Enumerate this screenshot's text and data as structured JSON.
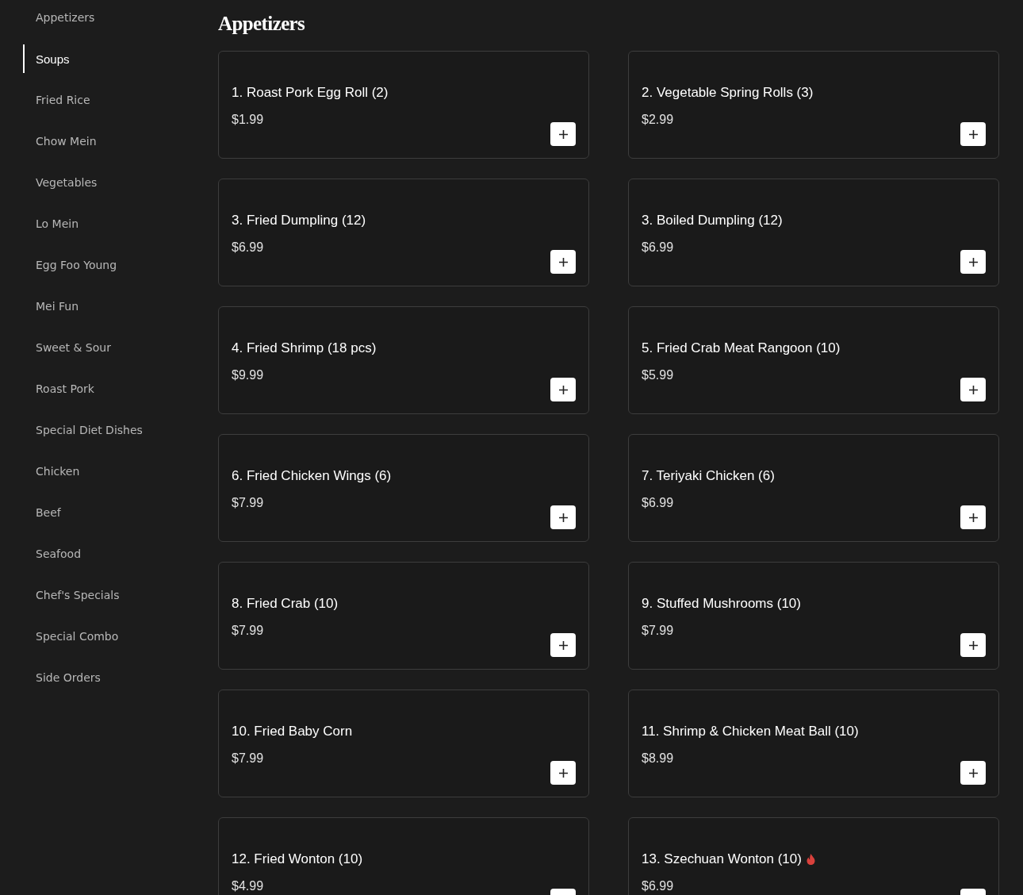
{
  "sidebar": {
    "items": [
      {
        "label": "Appetizers",
        "selected": false
      },
      {
        "label": "Soups",
        "selected": true
      },
      {
        "label": "Fried Rice",
        "selected": false
      },
      {
        "label": "Chow Mein",
        "selected": false
      },
      {
        "label": "Vegetables",
        "selected": false
      },
      {
        "label": "Lo Mein",
        "selected": false
      },
      {
        "label": "Egg Foo Young",
        "selected": false
      },
      {
        "label": "Mei Fun",
        "selected": false
      },
      {
        "label": "Sweet & Sour",
        "selected": false
      },
      {
        "label": "Roast Pork",
        "selected": false
      },
      {
        "label": "Special Diet Dishes",
        "selected": false
      },
      {
        "label": "Chicken",
        "selected": false
      },
      {
        "label": "Beef",
        "selected": false
      },
      {
        "label": "Seafood",
        "selected": false
      },
      {
        "label": "Chef's Specials",
        "selected": false
      },
      {
        "label": "Special Combo",
        "selected": false
      },
      {
        "label": "Side Orders",
        "selected": false
      }
    ]
  },
  "section": {
    "title": "Appetizers",
    "items": [
      {
        "name": "1. Roast Pork Egg Roll (2)",
        "price": "$1.99",
        "spicy": false
      },
      {
        "name": "2. Vegetable Spring Rolls (3)",
        "price": "$2.99",
        "spicy": false
      },
      {
        "name": "3. Fried Dumpling (12)",
        "price": "$6.99",
        "spicy": false
      },
      {
        "name": "3. Boiled Dumpling (12)",
        "price": "$6.99",
        "spicy": false
      },
      {
        "name": "4. Fried Shrimp (18 pcs)",
        "price": "$9.99",
        "spicy": false
      },
      {
        "name": "5. Fried Crab Meat Rangoon (10)",
        "price": "$5.99",
        "spicy": false
      },
      {
        "name": "6. Fried Chicken Wings (6)",
        "price": "$7.99",
        "spicy": false
      },
      {
        "name": "7. Teriyaki Chicken (6)",
        "price": "$6.99",
        "spicy": false
      },
      {
        "name": "8. Fried Crab (10)",
        "price": "$7.99",
        "spicy": false
      },
      {
        "name": "9. Stuffed Mushrooms (10)",
        "price": "$7.99",
        "spicy": false
      },
      {
        "name": "10. Fried Baby Corn",
        "price": "$7.99",
        "spicy": false
      },
      {
        "name": "11. Shrimp & Chicken Meat Ball (10)",
        "price": "$8.99",
        "spicy": false
      },
      {
        "name": "12. Fried Wonton (10)",
        "price": "$4.99",
        "spicy": false
      },
      {
        "name": "13. Szechuan Wonton (10)",
        "price": "$6.99",
        "spicy": true
      }
    ]
  }
}
